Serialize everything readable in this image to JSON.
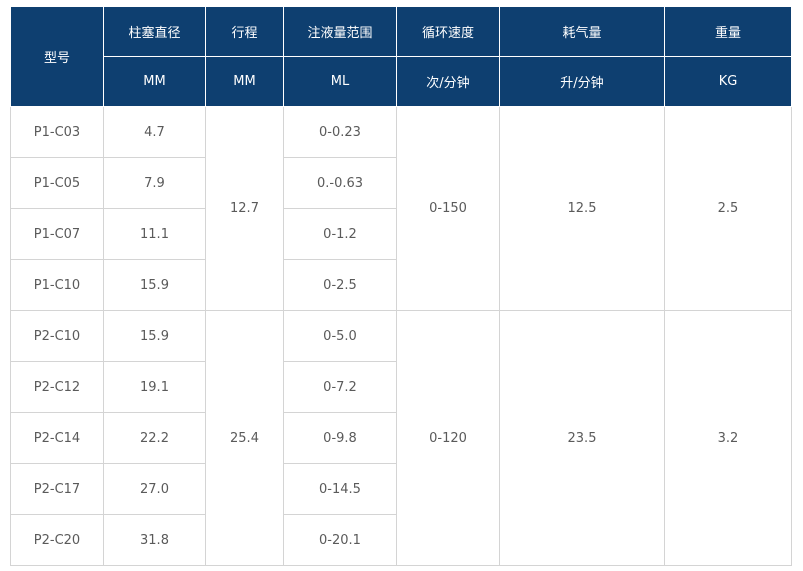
{
  "table": {
    "headers": {
      "model": "型号",
      "bore": "柱塞直径",
      "stroke": "行程",
      "volume": "注液量范围",
      "cycle": "循环速度",
      "air": "耗气量",
      "weight": "重量"
    },
    "units": {
      "bore": "MM",
      "stroke": "MM",
      "volume": "ML",
      "cycle": "次/分钟",
      "air": "升/分钟",
      "weight": "KG"
    },
    "groups": [
      {
        "stroke": "12.7",
        "cycle": "0-150",
        "air": "12.5",
        "weight": "2.5",
        "rows": [
          {
            "model": "P1-C03",
            "bore": "4.7",
            "volume": "0-0.23"
          },
          {
            "model": "P1-C05",
            "bore": "7.9",
            "volume": "0.-0.63"
          },
          {
            "model": "P1-C07",
            "bore": "11.1",
            "volume": "0-1.2"
          },
          {
            "model": "P1-C10",
            "bore": "15.9",
            "volume": "0-2.5"
          }
        ]
      },
      {
        "stroke": "25.4",
        "cycle": "0-120",
        "air": "23.5",
        "weight": "3.2",
        "rows": [
          {
            "model": "P2-C10",
            "bore": "15.9",
            "volume": "0-5.0"
          },
          {
            "model": "P2-C12",
            "bore": "19.1",
            "volume": "0-7.2"
          },
          {
            "model": "P2-C14",
            "bore": "22.2",
            "volume": "0-9.8"
          },
          {
            "model": "P2-C17",
            "bore": "27.0",
            "volume": "0-14.5"
          },
          {
            "model": "P2-C20",
            "bore": "31.8",
            "volume": "0-20.1"
          }
        ]
      }
    ]
  }
}
